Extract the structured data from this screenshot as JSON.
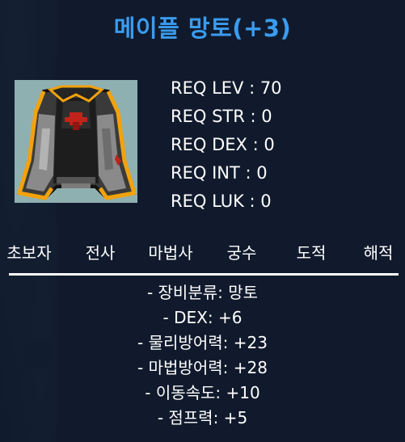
{
  "item": {
    "name": "메이플 망토(+3)",
    "icon": "cape-icon",
    "title_color": "#3a9cf0"
  },
  "requirements": [
    "REQ LEV : 70",
    "REQ STR : 0",
    "REQ DEX : 0",
    "REQ INT : 0",
    "REQ LUK : 0"
  ],
  "jobs": [
    "초보자",
    "전사",
    "마법사",
    "궁수",
    "도적",
    "해적"
  ],
  "stats": [
    "- 장비분류: 망토",
    "- DEX: +6",
    "- 물리방어력: +23",
    "- 마법방어력: +28",
    "- 이동속도: +10",
    "- 점프력: +5"
  ]
}
